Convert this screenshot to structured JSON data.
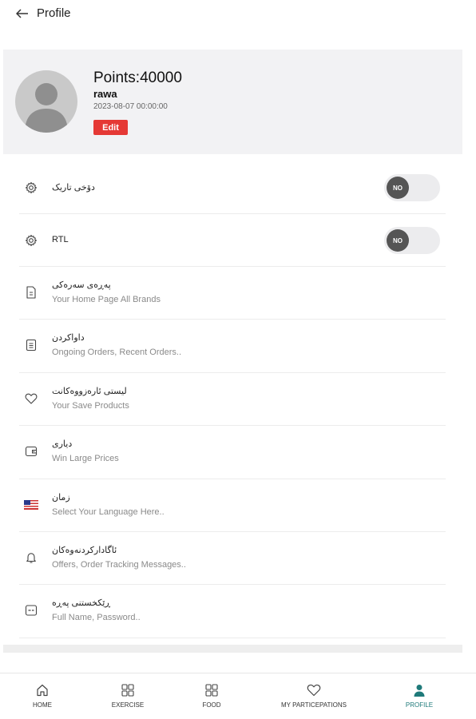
{
  "header": {
    "title": "Profile",
    "back_icon": "arrow-left-icon"
  },
  "profile": {
    "points": "Points:40000",
    "username": "rawa",
    "date": "2023-08-07 00:00:00",
    "edit_label": "Edit",
    "avatar_icon": "user-silhouette"
  },
  "toggles": [
    {
      "title": "دۆخی تاریک",
      "state": "NO",
      "icon": "gear-icon"
    },
    {
      "title": "RTL",
      "state": "NO",
      "icon": "gear-icon"
    }
  ],
  "menu": [
    {
      "title": "پەڕەی سەرەکی",
      "subtitle": "Your Home Page All Brands",
      "icon": "document-icon"
    },
    {
      "title": "داواکردن",
      "subtitle": "Ongoing Orders, Recent Orders..",
      "icon": "list-icon"
    },
    {
      "title": "لیستی ئارەزووەکانت",
      "subtitle": "Your Save Products",
      "icon": "heart-icon"
    },
    {
      "title": "دیاری",
      "subtitle": "Win Large Prices",
      "icon": "wallet-icon"
    },
    {
      "title": "زمان",
      "subtitle": "Select Your Language Here..",
      "icon": "us-flag-icon"
    },
    {
      "title": "ئاگادارکردنەوەکان",
      "subtitle": "Offers, Order Tracking Messages..",
      "icon": "bell-icon"
    },
    {
      "title": "ڕێکخستنی پەڕە",
      "subtitle": "Full Name, Password..",
      "icon": "card-icon"
    }
  ],
  "tabs": [
    {
      "label": "HOME",
      "icon": "home-icon",
      "active": false
    },
    {
      "label": "EXERCISE",
      "icon": "grid-icon",
      "active": false
    },
    {
      "label": "FOOD",
      "icon": "grid-icon",
      "active": false
    },
    {
      "label": "MY PARTICEPATIONS",
      "icon": "heart-icon",
      "active": false
    },
    {
      "label": "PROFILE",
      "icon": "person-icon",
      "active": true
    }
  ],
  "colors": {
    "accent": "#1f7a7a",
    "edit": "#e53935",
    "card_bg": "#f2f2f4"
  }
}
